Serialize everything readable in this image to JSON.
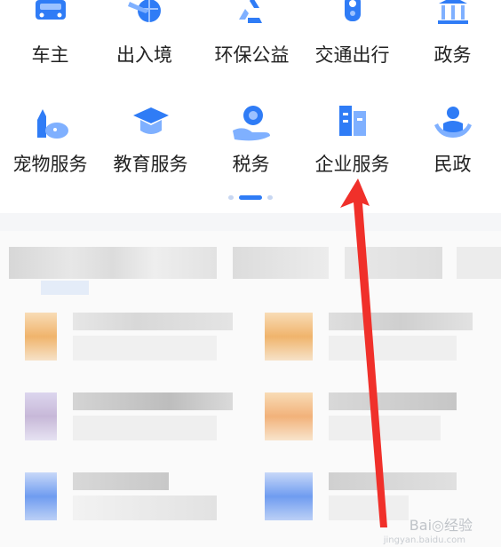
{
  "services": [
    {
      "label": "车主",
      "icon": "car-icon"
    },
    {
      "label": "出入境",
      "icon": "plane-globe-icon"
    },
    {
      "label": "环保公益",
      "icon": "recycle-icon"
    },
    {
      "label": "交通出行",
      "icon": "traffic-light-icon"
    },
    {
      "label": "政务",
      "icon": "government-building-icon"
    },
    {
      "label": "宠物服务",
      "icon": "pet-icon"
    },
    {
      "label": "教育服务",
      "icon": "graduation-cap-icon"
    },
    {
      "label": "税务",
      "icon": "tax-hand-icon"
    },
    {
      "label": "企业服务",
      "icon": "office-building-icon"
    },
    {
      "label": "民政",
      "icon": "people-care-icon"
    }
  ],
  "pagination": {
    "pages": 3,
    "active": 1
  },
  "watermark": {
    "text": "Bai◎经验",
    "sub": "jingyan.baidu.com"
  },
  "colors": {
    "accent": "#2f7cf6",
    "annotation_arrow": "#f0302a"
  }
}
